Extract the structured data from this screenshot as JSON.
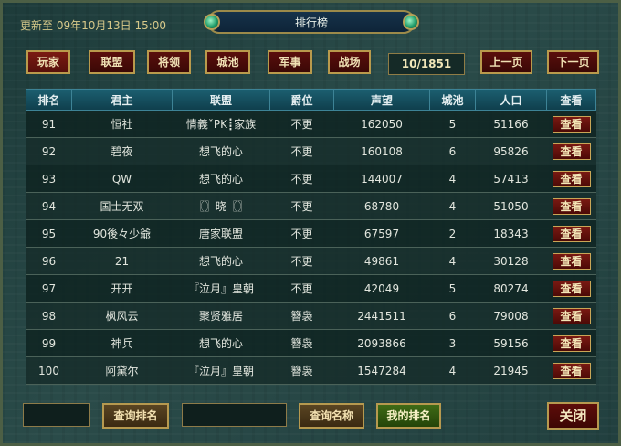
{
  "header": {
    "updated": "更新至 09年10月13日 15:00",
    "title": "排行榜"
  },
  "tabs": [
    {
      "label": "玩家",
      "selected": true
    },
    {
      "label": "联盟",
      "selected": false
    },
    {
      "label": "将领",
      "selected": false
    },
    {
      "label": "城池",
      "selected": false
    },
    {
      "label": "军事",
      "selected": false
    },
    {
      "label": "战场",
      "selected": false
    }
  ],
  "pagination": {
    "page_info": "10/1851",
    "prev_label": "上一页",
    "next_label": "下一页"
  },
  "table": {
    "columns": [
      "排名",
      "君主",
      "联盟",
      "爵位",
      "声望",
      "城池",
      "人口",
      "查看"
    ],
    "view_label": "查看",
    "rows": [
      [
        "91",
        "恒社",
        "情義ˇPK┋家族",
        "不更",
        "162050",
        "5",
        "51166"
      ],
      [
        "92",
        "碧夜",
        "想飞的心",
        "不更",
        "160108",
        "6",
        "95826"
      ],
      [
        "93",
        "QW",
        "想飞的心",
        "不更",
        "144007",
        "4",
        "57413"
      ],
      [
        "94",
        "国士无双",
        "〖〗晓〖〗",
        "不更",
        "68780",
        "4",
        "51050"
      ],
      [
        "95",
        "90後々少爺",
        "唐家联盟",
        "不更",
        "67597",
        "2",
        "18343"
      ],
      [
        "96",
        "21",
        "想飞的心",
        "不更",
        "49861",
        "4",
        "30128"
      ],
      [
        "97",
        "开开",
        "『泣月』皇朝",
        "不更",
        "42049",
        "5",
        "80274"
      ],
      [
        "98",
        "枫风云",
        "聚贤雅居",
        "簪袅",
        "2441511",
        "6",
        "79008"
      ],
      [
        "99",
        "神兵",
        "想飞的心",
        "簪袅",
        "2093866",
        "3",
        "59156"
      ],
      [
        "100",
        "阿黛尔",
        "『泣月』皇朝",
        "簪袅",
        "1547284",
        "4",
        "21945"
      ]
    ]
  },
  "footer": {
    "rank_query_value": "",
    "rank_query_label": "查询排名",
    "name_query_value": "",
    "name_query_label": "查询名称",
    "my_rank_label": "我的排名",
    "close_label": "关闭"
  }
}
